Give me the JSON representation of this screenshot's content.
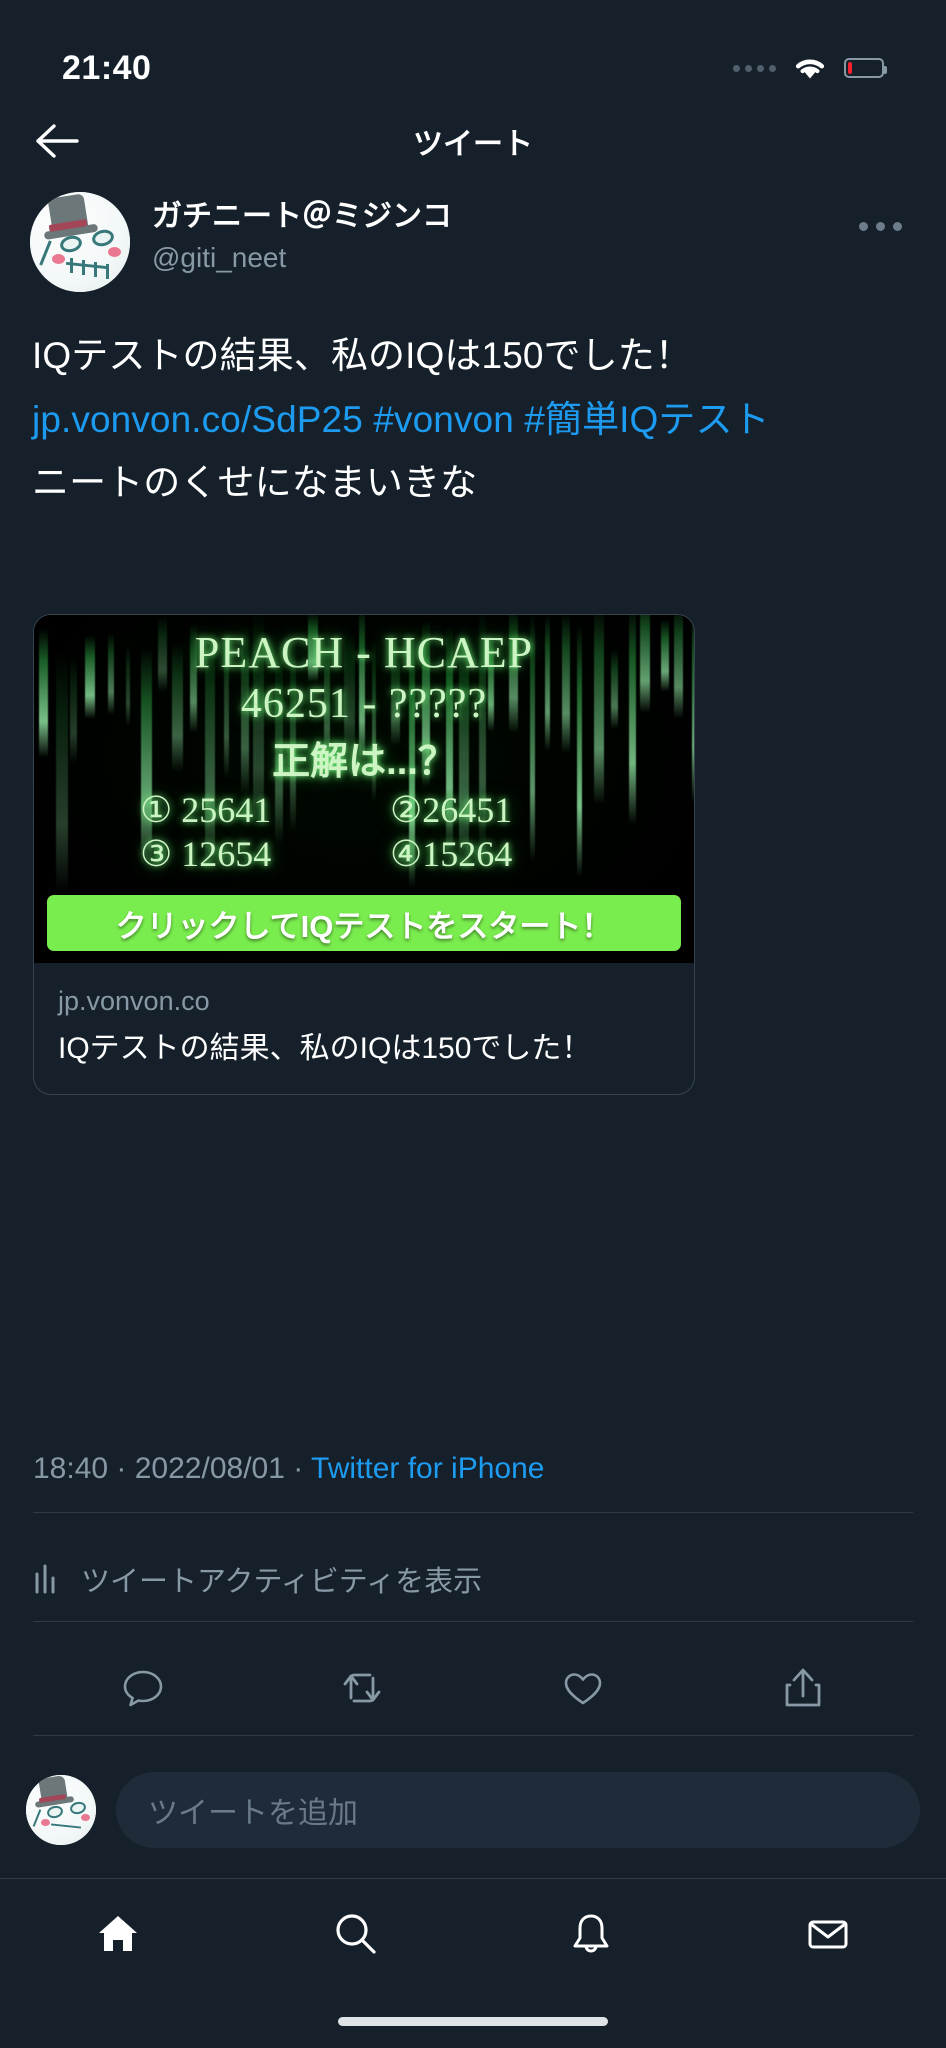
{
  "status_bar": {
    "time": "21:40",
    "icons": {
      "cellular": "signal-dots-icon",
      "wifi": "wifi-icon",
      "battery": "battery-low-icon"
    },
    "battery_level_pct": 14
  },
  "nav": {
    "back_icon": "arrow-left-icon",
    "title": "ツイート"
  },
  "tweet": {
    "avatar_alt": "ghost-avatar",
    "display_name": "ガチニート＠ミジンコ",
    "handle": "@giti_neet",
    "more_icon": "ellipsis-icon",
    "body": {
      "segment1": "IQテストの結果、私のIQは150でした！ ",
      "link": "jp.vonvon.co/SdP25",
      "space": " ",
      "hashtag1": "#vonvon",
      "hashtag2": "#簡単IQテスト",
      "segment2": "ニートのくせになまいきな"
    },
    "timestamp_time": "18:40",
    "timestamp_sep1": " · ",
    "timestamp_date": "2022/08/01",
    "timestamp_sep2": " · ",
    "source": "Twitter for iPhone",
    "activity_icon": "bar-chart-icon",
    "activity_label": "ツイートアクティビティを表示",
    "actions": [
      {
        "name": "reply-button",
        "icon": "comment-icon"
      },
      {
        "name": "retweet-button",
        "icon": "retweet-icon"
      },
      {
        "name": "like-button",
        "icon": "heart-icon"
      },
      {
        "name": "share-button",
        "icon": "share-icon"
      }
    ]
  },
  "card": {
    "image": {
      "alt": "matrix-iq-test-banner",
      "line1": "PEACH - HCAEP",
      "line2": "46251 - ?????",
      "line3": "正解は...？",
      "options": [
        "① 25641",
        "②26451",
        "③ 12654",
        "④15264"
      ],
      "cta_label": "クリックしてIQテストをスタート！",
      "cta_color": "#7aed4e"
    },
    "domain": "jp.vonvon.co",
    "title": "IQテストの結果、私のIQは150でした！"
  },
  "compose": {
    "avatar_alt": "ghost-avatar-small",
    "placeholder": "ツイートを追加"
  },
  "tabbar": [
    {
      "name": "tab-home",
      "icon": "home-icon",
      "active": true
    },
    {
      "name": "tab-search",
      "icon": "search-icon",
      "active": false
    },
    {
      "name": "tab-notifications",
      "icon": "bell-icon",
      "active": false
    },
    {
      "name": "tab-messages",
      "icon": "mail-icon",
      "active": false
    }
  ],
  "colors": {
    "background": "#15202b",
    "link": "#1d9bf0",
    "muted": "#8899a6",
    "battery_low": "#f4212e"
  }
}
